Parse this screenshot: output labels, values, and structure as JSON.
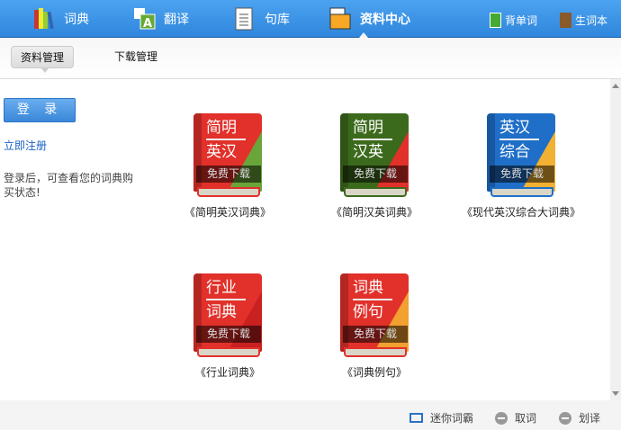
{
  "nav": {
    "items": [
      {
        "label": "词典"
      },
      {
        "label": "翻译"
      },
      {
        "label": "句库"
      },
      {
        "label": "资料中心"
      }
    ],
    "right": [
      {
        "label": "背单词"
      },
      {
        "label": "生词本"
      }
    ]
  },
  "subtabs": [
    {
      "label": "资料管理"
    },
    {
      "label": "下载管理"
    }
  ],
  "sidebar": {
    "login": "登 录",
    "register": "立即注册",
    "tip": "登录后，可查看您的词典购买状态!"
  },
  "books": [
    {
      "line1": "简明",
      "line2": "英汉",
      "download": "免费下载",
      "name": "《简明英汉词典》",
      "color": "#e2302a",
      "corner": "#6aa53a"
    },
    {
      "line1": "简明",
      "line2": "汉英",
      "download": "免费下载",
      "name": "《简明汉英词典》",
      "color": "#3c6a1c",
      "corner": "#e2302a"
    },
    {
      "line1": "英汉",
      "line2": "综合",
      "download": "免费下载",
      "name": "《现代英汉综合大词典》",
      "color": "#1f6fc8",
      "corner": "#f2b132"
    },
    {
      "line1": "行业",
      "line2": "词典",
      "download": "免费下载",
      "name": "《行业词典》",
      "color": "#e2302a",
      "corner": "#c92020"
    },
    {
      "line1": "词典",
      "line2": "例句",
      "download": "免费下载",
      "name": "《词典例句》",
      "color": "#e2302a",
      "corner": "#f2a030"
    }
  ],
  "footer": {
    "mini": "迷你词霸",
    "pick": "取词",
    "translate": "划译"
  }
}
